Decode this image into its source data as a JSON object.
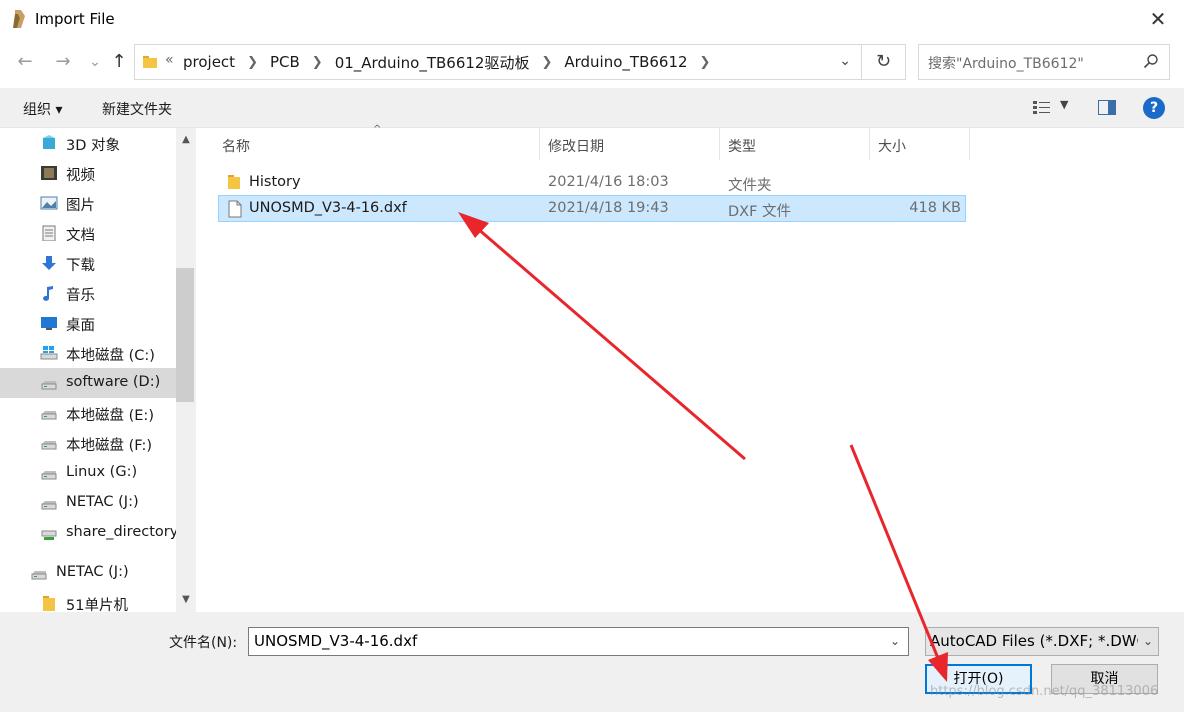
{
  "window": {
    "title": "Import File",
    "close_glyph": "✕"
  },
  "nav": {
    "back_glyph": "←",
    "forward_glyph": "→",
    "recent_glyph": "⌄",
    "up_glyph": "↑",
    "overflow_glyph": "«",
    "breadcrumbs": [
      "project",
      "PCB",
      "01_Arduino_TB6612驱动板",
      "Arduino_TB6612"
    ],
    "refresh_glyph": "↻",
    "search_placeholder": "搜索\"Arduino_TB6612\""
  },
  "toolbar": {
    "organize_label": "组织 ▾",
    "new_folder_label": "新建文件夹",
    "help_glyph": "?"
  },
  "sidebar": {
    "items": [
      {
        "label": "3D 对象",
        "icon": "3d-objects-icon"
      },
      {
        "label": "视频",
        "icon": "video-icon"
      },
      {
        "label": "图片",
        "icon": "pictures-icon"
      },
      {
        "label": "文档",
        "icon": "documents-icon"
      },
      {
        "label": "下载",
        "icon": "downloads-icon"
      },
      {
        "label": "音乐",
        "icon": "music-icon"
      },
      {
        "label": "桌面",
        "icon": "desktop-icon"
      },
      {
        "label": "本地磁盘 (C:)",
        "icon": "windows-drive-icon"
      },
      {
        "label": "software (D:)",
        "icon": "drive-icon"
      },
      {
        "label": "本地磁盘 (E:)",
        "icon": "drive-icon"
      },
      {
        "label": "本地磁盘 (F:)",
        "icon": "drive-icon"
      },
      {
        "label": "Linux (G:)",
        "icon": "drive-icon"
      },
      {
        "label": "NETAC (J:)",
        "icon": "drive-icon"
      },
      {
        "label": "share_directory",
        "icon": "network-drive-icon"
      },
      {
        "label": "NETAC (J:)",
        "icon": "drive-icon"
      },
      {
        "label": "51单片机",
        "icon": "folder-icon"
      }
    ],
    "selected_index": 8
  },
  "columns": {
    "name": "名称",
    "date": "修改日期",
    "type": "类型",
    "size": "大小"
  },
  "files": [
    {
      "name": "History",
      "date": "2021/4/16 18:03",
      "type": "文件夹",
      "size": "",
      "icon": "folder-icon"
    },
    {
      "name": "UNOSMD_V3-4-16.dxf",
      "date": "2021/4/18 19:43",
      "type": "DXF 文件",
      "size": "418 KB",
      "icon": "file-icon"
    }
  ],
  "selected_file_index": 1,
  "bottom": {
    "filename_label": "文件名(N):",
    "filename_value": "UNOSMD_V3-4-16.dxf",
    "filter_value": "AutoCAD Files (*.DXF; *.DWG",
    "open_label": "打开(O)",
    "cancel_label": "取消",
    "watermark": "https://blog.csdn.net/qq_38113006"
  },
  "colors": {
    "accent": "#0078d7",
    "selection": "#cce8ff",
    "annotation": "#e8262b"
  }
}
